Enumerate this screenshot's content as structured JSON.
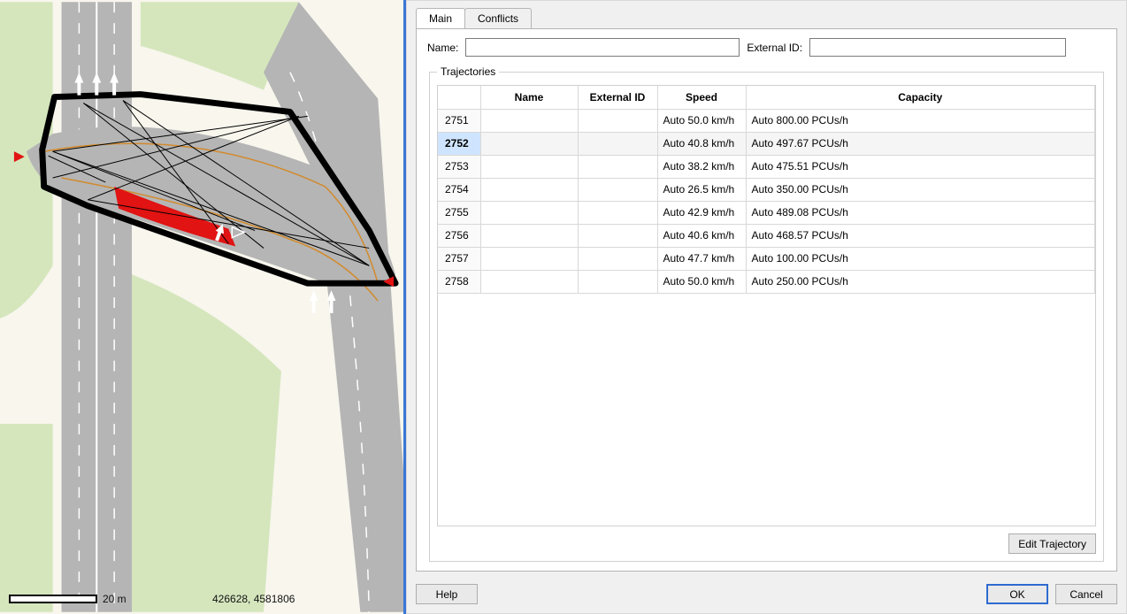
{
  "map": {
    "scale_label": "20 m",
    "coords": "426628, 4581806"
  },
  "tabs": {
    "main": "Main",
    "conflicts": "Conflicts"
  },
  "form": {
    "name_label": "Name:",
    "name_value": "",
    "extid_label": "External ID:",
    "extid_value": ""
  },
  "trajectories": {
    "legend": "Trajectories",
    "columns": {
      "name": "Name",
      "external_id": "External ID",
      "speed": "Speed",
      "capacity": "Capacity"
    },
    "selected_id": "2752",
    "rows": [
      {
        "id": "2751",
        "name": "",
        "external_id": "",
        "speed": "Auto 50.0 km/h",
        "capacity": "Auto 800.00 PCUs/h"
      },
      {
        "id": "2752",
        "name": "",
        "external_id": "",
        "speed": "Auto 40.8 km/h",
        "capacity": "Auto 497.67 PCUs/h"
      },
      {
        "id": "2753",
        "name": "",
        "external_id": "",
        "speed": "Auto 38.2 km/h",
        "capacity": "Auto 475.51 PCUs/h"
      },
      {
        "id": "2754",
        "name": "",
        "external_id": "",
        "speed": "Auto 26.5 km/h",
        "capacity": "Auto 350.00 PCUs/h"
      },
      {
        "id": "2755",
        "name": "",
        "external_id": "",
        "speed": "Auto 42.9 km/h",
        "capacity": "Auto 489.08 PCUs/h"
      },
      {
        "id": "2756",
        "name": "",
        "external_id": "",
        "speed": "Auto 40.6 km/h",
        "capacity": "Auto 468.57 PCUs/h"
      },
      {
        "id": "2757",
        "name": "",
        "external_id": "",
        "speed": "Auto 47.7 km/h",
        "capacity": "Auto 100.00 PCUs/h"
      },
      {
        "id": "2758",
        "name": "",
        "external_id": "",
        "speed": "Auto 50.0 km/h",
        "capacity": "Auto 250.00 PCUs/h"
      }
    ]
  },
  "buttons": {
    "edit_trajectory": "Edit Trajectory",
    "help": "Help",
    "ok": "OK",
    "cancel": "Cancel"
  }
}
